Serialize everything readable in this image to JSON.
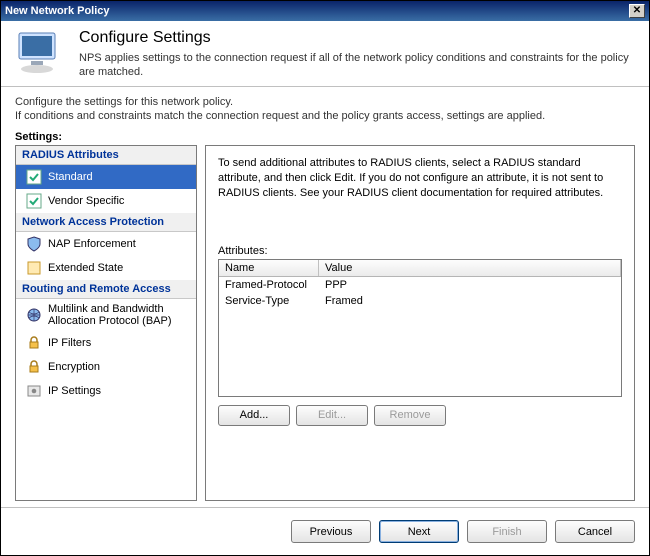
{
  "window": {
    "title": "New Network Policy"
  },
  "header": {
    "title": "Configure Settings",
    "subtitle": "NPS applies settings to the connection request if all of the network policy conditions and constraints for the policy are matched."
  },
  "instructions": {
    "line1": "Configure the settings for this network policy.",
    "line2": "If conditions and constraints match the connection request and the policy grants access, settings are applied."
  },
  "settings_label": "Settings:",
  "sidebar": {
    "categories": [
      {
        "label": "RADIUS Attributes",
        "items": [
          {
            "label": "Standard",
            "selected": true,
            "icon": "check"
          },
          {
            "label": "Vendor Specific",
            "selected": false,
            "icon": "check"
          }
        ]
      },
      {
        "label": "Network Access Protection",
        "items": [
          {
            "label": "NAP Enforcement",
            "selected": false,
            "icon": "shield"
          },
          {
            "label": "Extended State",
            "selected": false,
            "icon": "state"
          }
        ]
      },
      {
        "label": "Routing and Remote Access",
        "items": [
          {
            "label": "Multilink and Bandwidth Allocation Protocol (BAP)",
            "selected": false,
            "icon": "globe"
          },
          {
            "label": "IP Filters",
            "selected": false,
            "icon": "lock"
          },
          {
            "label": "Encryption",
            "selected": false,
            "icon": "lock"
          },
          {
            "label": "IP Settings",
            "selected": false,
            "icon": "settings"
          }
        ]
      }
    ]
  },
  "detail": {
    "description": "To send additional attributes to RADIUS clients, select a RADIUS standard attribute, and then click Edit. If you do not configure an attribute, it is not sent to RADIUS clients. See your RADIUS client documentation for required attributes.",
    "attributes_label": "Attributes:",
    "columns": {
      "name": "Name",
      "value": "Value"
    },
    "rows": [
      {
        "name": "Framed-Protocol",
        "value": "PPP"
      },
      {
        "name": "Service-Type",
        "value": "Framed"
      }
    ],
    "buttons": {
      "add": "Add...",
      "edit": "Edit...",
      "remove": "Remove"
    }
  },
  "footer": {
    "previous": "Previous",
    "next": "Next",
    "finish": "Finish",
    "cancel": "Cancel"
  }
}
